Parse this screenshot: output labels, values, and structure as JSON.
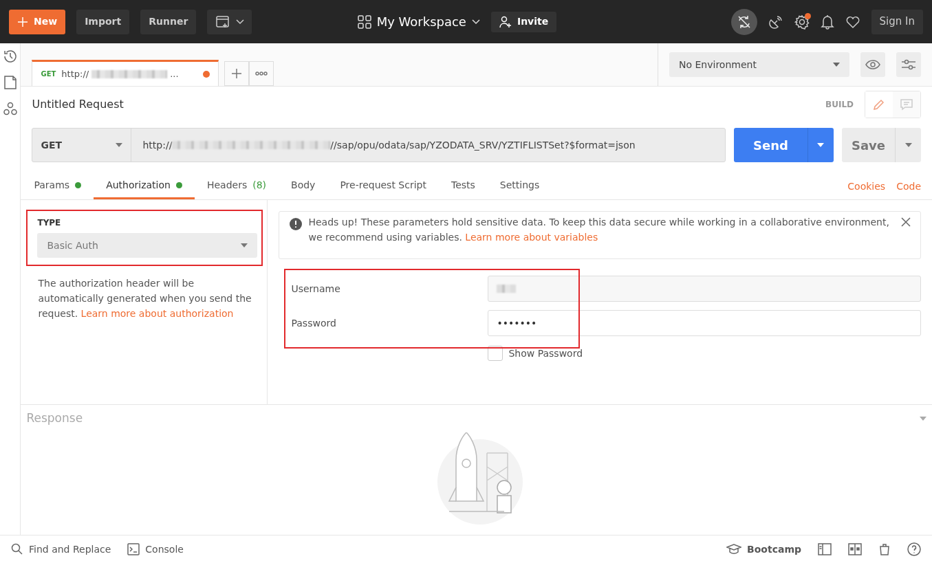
{
  "header": {
    "new_button": "New",
    "buttons": [
      "Import",
      "Runner"
    ],
    "workspace": "My Workspace",
    "invite": "Invite",
    "settings_badge": true,
    "sign_in": "Sign In"
  },
  "request_tabs": [
    {
      "method": "GET",
      "title_prefix": "http://",
      "title_suffix": "...",
      "unsaved": true,
      "selected": true
    }
  ],
  "environment": {
    "value": "No Environment"
  },
  "request": {
    "name": "Untitled Request",
    "mode": "BUILD",
    "method": "GET",
    "url_prefix": "http://",
    "url_suffix": "//sap/opu/odata/sap/YZODATA_SRV/YZTIFLISTSet?$format=json",
    "send": "Send",
    "save": "Save"
  },
  "sub_tabs": [
    {
      "label": "Params",
      "dot": true,
      "selected": false
    },
    {
      "label": "Authorization",
      "dot": true,
      "selected": true
    },
    {
      "label": "Headers",
      "dot": false,
      "count": "(8)",
      "selected": false
    },
    {
      "label": "Body",
      "dot": false,
      "selected": false
    },
    {
      "label": "Pre-request Script",
      "dot": false,
      "selected": false
    },
    {
      "label": "Tests",
      "dot": false,
      "selected": false
    },
    {
      "label": "Settings",
      "dot": false,
      "selected": false
    }
  ],
  "sub_links": [
    "Cookies",
    "Code"
  ],
  "auth": {
    "type_label": "TYPE",
    "type_value": "Basic Auth",
    "type_highlighted": true,
    "description": "The authorization header will be automatically generated when you send the request.",
    "description_link": "Learn more about authorization",
    "notice": "Heads up! These parameters hold sensitive data. To keep this data secure while working in a collaborative environment, we recommend using variables.",
    "notice_link": "Learn more about variables",
    "credentials_highlighted": true,
    "username_label": "Username",
    "password_label": "Password",
    "password_value": "•••••••",
    "show_password": {
      "label": "Show Password",
      "checked": false
    }
  },
  "response": {
    "title": "Response"
  },
  "status_bar": {
    "left": [
      "Find and Replace",
      "Console"
    ],
    "bootcamp": "Bootcamp"
  }
}
